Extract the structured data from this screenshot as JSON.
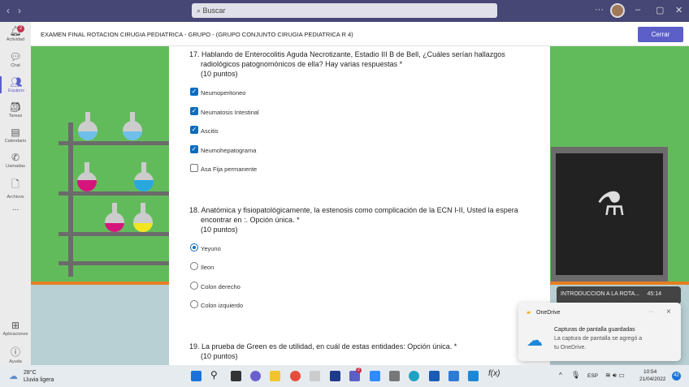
{
  "topbar": {
    "search_placeholder": "Buscar"
  },
  "sidebar": {
    "items": [
      {
        "label": "Actividad",
        "badge": "2"
      },
      {
        "label": "Chat"
      },
      {
        "label": "Equipos"
      },
      {
        "label": "Tareas"
      },
      {
        "label": "Calendario"
      },
      {
        "label": "Llamadas"
      },
      {
        "label": "Archivos"
      },
      {
        "label": "..."
      },
      {
        "label": "Aplicaciones"
      },
      {
        "label": "Ayuda"
      }
    ]
  },
  "header": {
    "title": "EXAMEN FINAL ROTACION CIRUGIA PEDIATRICA - GRUPO - (GRUPO CONJUNTO CIRUGIA PEDIATRICA R 4)",
    "close_label": "Cerrar"
  },
  "questions": [
    {
      "text": "17. Hablando de Enterocolitis Aguda Necrotizante, Estadio III B de Bell, ¿Cuáles serían hallazgos",
      "text2": "radiológicos patognomónicos de ella? Hay varias respuestas *",
      "points": "(10 puntos)",
      "options": [
        {
          "label": "Neumoperitoneo",
          "checked": true
        },
        {
          "label": "Neumatosis Intestinal",
          "checked": true
        },
        {
          "label": "Ascitis",
          "checked": true
        },
        {
          "label": "Neumohepatograma",
          "checked": true
        },
        {
          "label": "Asa Fija permanente",
          "checked": false
        }
      ]
    },
    {
      "text": "18. Anatómica y fisiopatológicamente, la estenosis como complicación de la ECN I-II, Usted la espera",
      "text2": "encontrar en :. Opción única. *",
      "points": "(10 puntos)",
      "options": [
        {
          "label": "Yeyuno",
          "checked": true
        },
        {
          "label": "Ileon",
          "checked": false
        },
        {
          "label": "Colon derecho",
          "checked": false
        },
        {
          "label": "Colon izquierdo",
          "checked": false
        }
      ]
    },
    {
      "text": "19. La prueba de Green es de utilidad, en cuál de estas entidades: Opción única. *",
      "points": "(10 puntos)"
    }
  ],
  "video": {
    "title": "INTRODUCCION A LA ROTA...",
    "time": "45:14"
  },
  "toast": {
    "app": "OneDrive",
    "title": "Capturas de pantalla guardadas",
    "body1": "La captura de pantalla se agregó a",
    "body2": "tu OneDrive.",
    "more": "···",
    "close": "×"
  },
  "taskbar": {
    "temp": "28°C",
    "weather": "Lluvia ligera",
    "lang": "ESP",
    "time": "10:54",
    "date": "21/04/2022",
    "notif": "42",
    "teams_badge": "2"
  }
}
